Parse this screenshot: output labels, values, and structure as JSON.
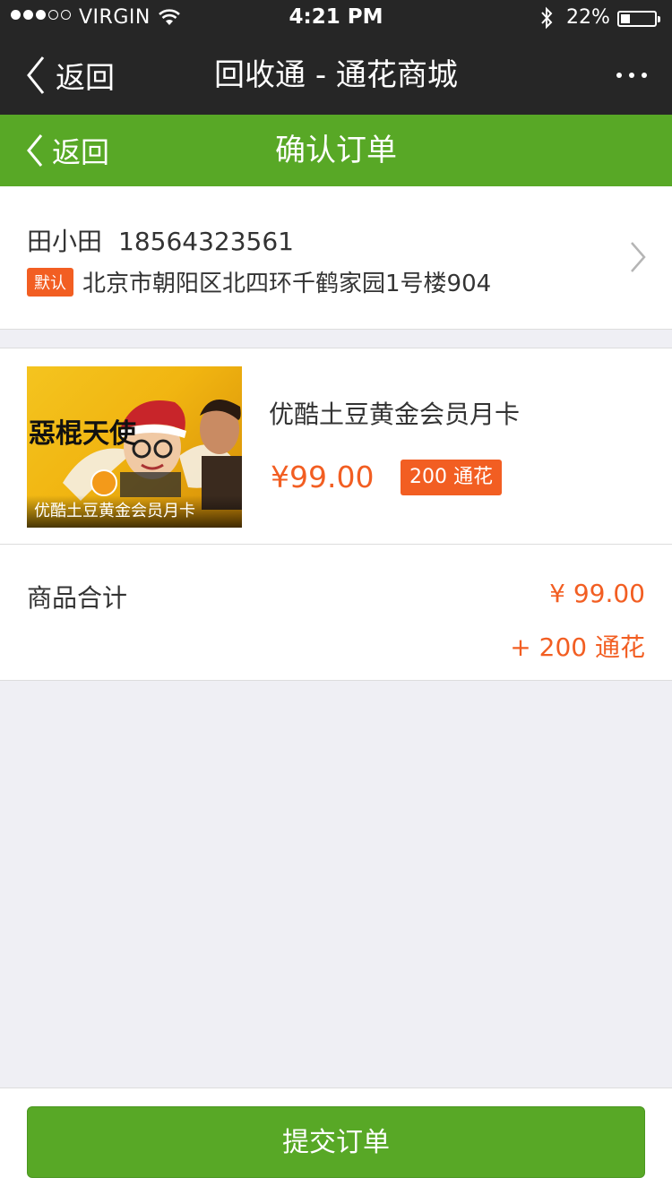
{
  "status_bar": {
    "carrier": "VIRGIN",
    "time": "4:21 PM",
    "battery": "22%",
    "battery_level": 0.22
  },
  "wechat_header": {
    "back_label": "返回",
    "title": "回收通 - 通花商城",
    "more_icon": "more-icon"
  },
  "nav": {
    "back_label": "返回",
    "title": "确认订单",
    "background": "#58a826"
  },
  "address": {
    "name": "田小田",
    "phone": "18564323561",
    "default_badge": "默认",
    "detail": "北京市朝阳区北四环千鹤家园1号楼904"
  },
  "product": {
    "thumbnail_caption": "优酷土豆黄金会员月卡",
    "name": "优酷土豆黄金会员月卡",
    "price": "¥99.00",
    "coins": "200 通花"
  },
  "summary": {
    "label": "商品合计",
    "price": "¥ 99.00",
    "coins": "+ 200 通花"
  },
  "footer": {
    "submit_label": "提交订单"
  },
  "colors": {
    "accent": "#f25e22",
    "primary": "#58a826",
    "header": "#262626"
  }
}
